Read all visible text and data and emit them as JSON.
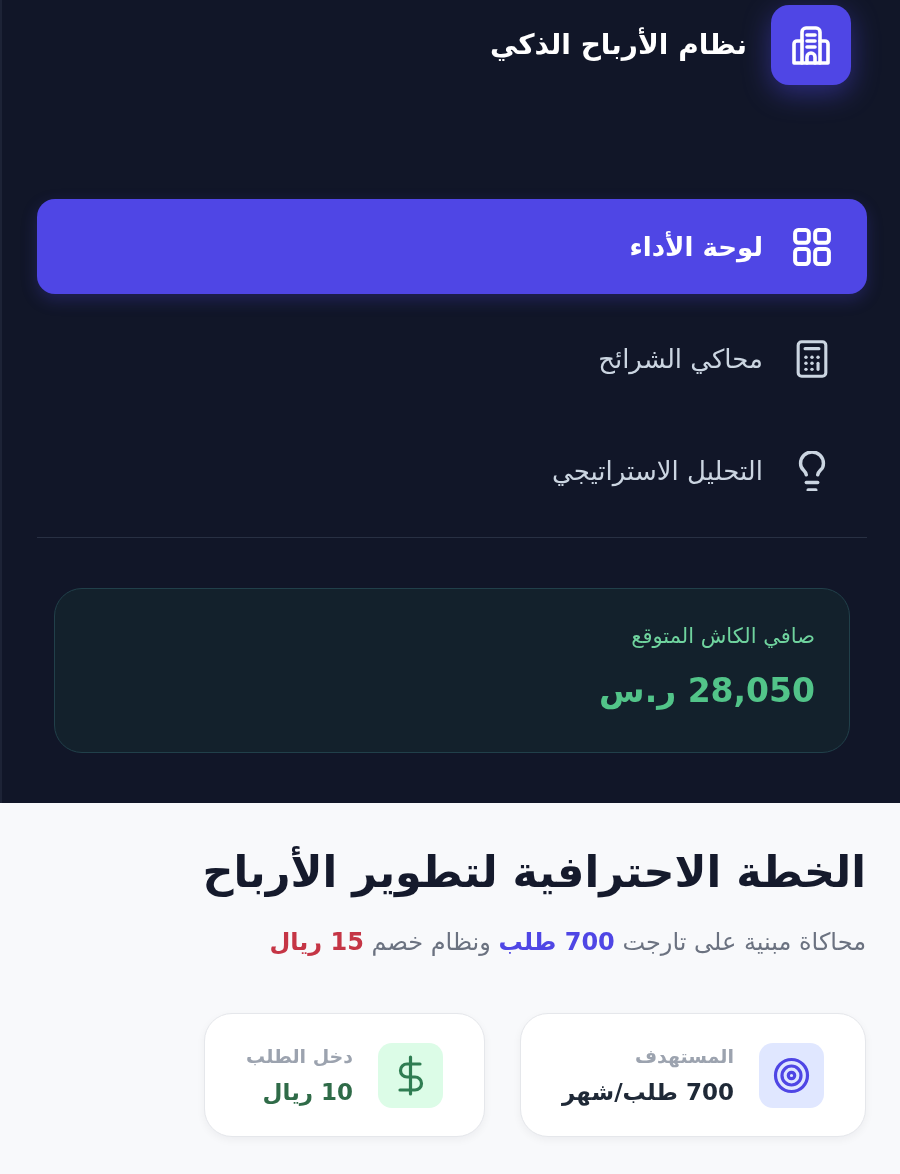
{
  "sidebar": {
    "brand": {
      "title": "نظام الأرباح الذكي"
    },
    "nav": [
      {
        "label": "لوحة الأداء",
        "selected": true
      },
      {
        "label": "محاكي الشرائح",
        "selected": false
      },
      {
        "label": "التحليل الاستراتيجي",
        "selected": false
      }
    ],
    "cash_card": {
      "label": "صافي الكاش المتوقع",
      "value": "28,050 ر.س"
    }
  },
  "main": {
    "title": "الخطة الاحترافية لتطوير الأرباح",
    "subtitle": "محاكاة مبنية على تارجت **700 طلب** ونظام خصم **15 ريال**",
    "stats": [
      {
        "kind": "target",
        "label": "المستهدف",
        "value": "700 طلب/شهر"
      },
      {
        "kind": "income",
        "label": "دخل الطلب",
        "value": "10 ريال"
      }
    ]
  }
}
